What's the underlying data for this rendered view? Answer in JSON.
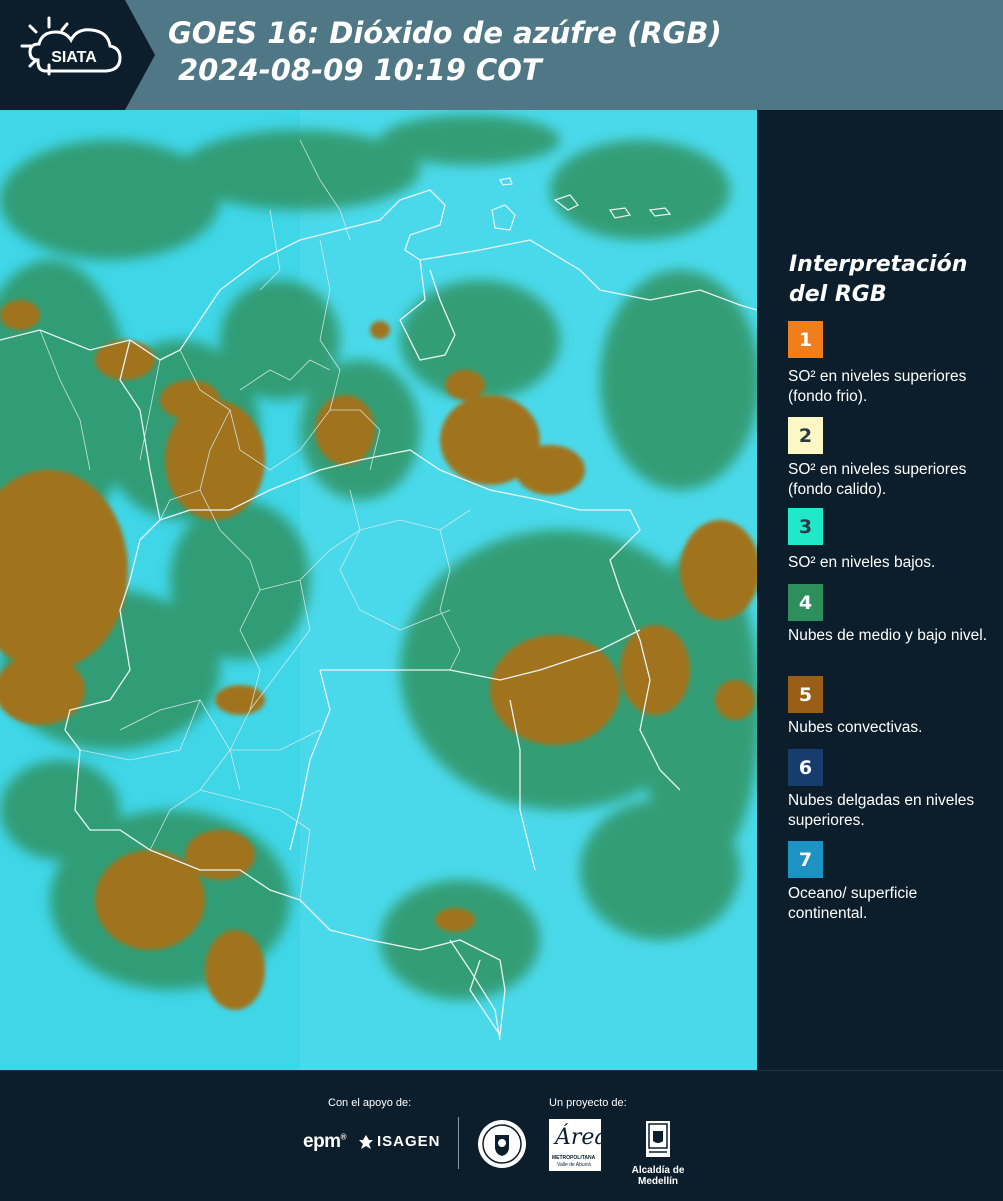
{
  "header": {
    "logo_text": "SIATA",
    "title_line1": "GOES 16: Dióxido de azúfre (RGB)",
    "title_line2": "2024-08-09 10:19 COT"
  },
  "legend": {
    "title": "Interpretación del RGB",
    "items": [
      {
        "number": "1",
        "color": "#f07e1a",
        "text_color": "#ffffff",
        "label": "SO² en niveles superiores (fondo frio)."
      },
      {
        "number": "2",
        "color": "#fcf7c4",
        "text_color": "#2a3a44",
        "label": "SO² en niveles superiores (fondo calido)."
      },
      {
        "number": "3",
        "color": "#1fe9c8",
        "text_color": "#2a3a44",
        "label": "SO² en niveles bajos."
      },
      {
        "number": "4",
        "color": "#2d8f5c",
        "text_color": "#ffffff",
        "label": "Nubes de medio y bajo nivel."
      },
      {
        "number": "5",
        "color": "#9a5f16",
        "text_color": "#ffffff",
        "label": "Nubes convectivas."
      },
      {
        "number": "6",
        "color": "#173c6e",
        "text_color": "#ffffff",
        "label": "Nubes delgadas en niveles superiores."
      },
      {
        "number": "7",
        "color": "#1d93c4",
        "text_color": "#ffffff",
        "label": "Oceano/ superficie continental."
      }
    ]
  },
  "map": {
    "background_color": "#3fd6e8",
    "convective_color": "#a0731c",
    "cloud_color": "#2f8f5a",
    "border_color": "#e8f4f6"
  },
  "footer": {
    "support_label": "Con el apoyo de:",
    "project_label": "Un proyecto de:",
    "sponsors": [
      "epm",
      "ISAGEN"
    ],
    "epm_mark": "®",
    "area_logo_word": "Área",
    "area_logo_sub1": "METROPOLITANA",
    "area_logo_sub2": "Valle de Aburrá",
    "alcaldia_text": "Alcaldía de Medellín"
  }
}
